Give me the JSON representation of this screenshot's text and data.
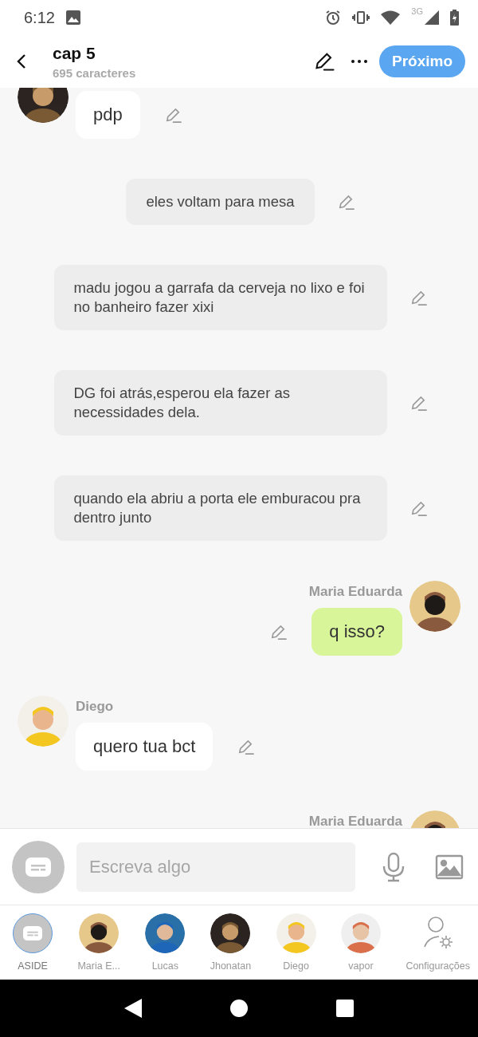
{
  "status_bar": {
    "time": "6:12",
    "network": "3G"
  },
  "header": {
    "title": "cap 5",
    "subtitle": "695 caracteres",
    "next_button": "Próximo"
  },
  "messages": [
    {
      "kind": "left",
      "text": "pdp"
    },
    {
      "kind": "narration",
      "text": "eles voltam para mesa"
    },
    {
      "kind": "narration",
      "text": "madu jogou a garrafa da cerveja no lixo e foi no banheiro fazer xixi"
    },
    {
      "kind": "narration",
      "text": "DG foi atrás,esperou ela fazer as necessidades dela."
    },
    {
      "kind": "narration",
      "text": "quando ela abriu a porta ele emburacou pra dentro junto"
    },
    {
      "kind": "right",
      "name": "Maria Eduarda",
      "text": "q isso?"
    },
    {
      "kind": "left",
      "name": "Diego",
      "text": "quero tua bct"
    },
    {
      "kind": "right",
      "name": "Maria Eduarda"
    }
  ],
  "composer": {
    "placeholder": "Escreva algo"
  },
  "characters": [
    {
      "kind": "aside",
      "label": "ASIDE",
      "selected": true
    },
    {
      "kind": "avatar",
      "label": "Maria E...",
      "selected": false
    },
    {
      "kind": "avatar",
      "label": "Lucas",
      "selected": false
    },
    {
      "kind": "avatar",
      "label": "Jhonatan",
      "selected": false
    },
    {
      "kind": "avatar",
      "label": "Diego",
      "selected": false
    },
    {
      "kind": "avatar",
      "label": "vapor",
      "selected": false
    },
    {
      "kind": "settings",
      "label": "Configurações",
      "selected": false
    }
  ]
}
